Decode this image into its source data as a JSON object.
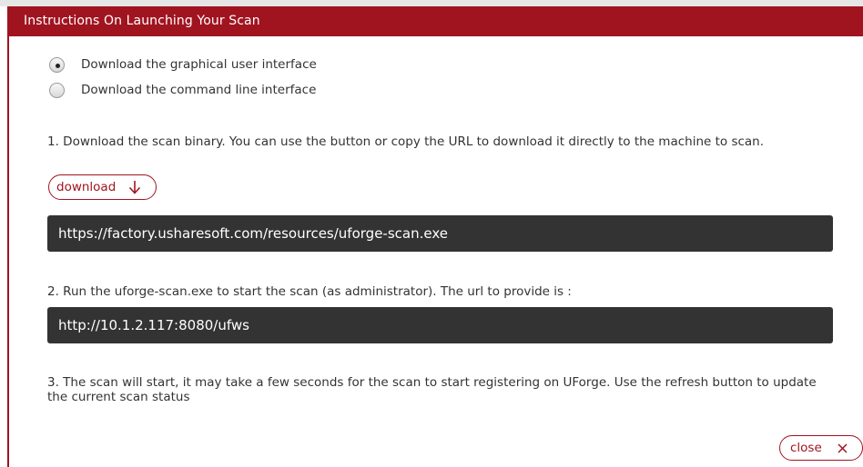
{
  "dialog": {
    "title": "Instructions On Launching Your Scan",
    "options": [
      {
        "label": "Download the graphical user interface",
        "selected": true
      },
      {
        "label": "Download the command line interface",
        "selected": false
      }
    ],
    "step1": "1. Download the scan binary. You can use the button or copy the URL to download it directly to the machine to scan.",
    "download_label": "download",
    "binary_url": "https://factory.usharesoft.com/resources/uforge-scan.exe",
    "step2": "2. Run the uforge-scan.exe to start the scan (as administrator). The url to provide is :",
    "ws_url": "http://10.1.2.117:8080/ufws",
    "step3": "3. The scan will start, it may take a few seconds for the scan to start registering on UForge. Use the refresh button to update the current scan status",
    "close_label": "close"
  },
  "colors": {
    "accent": "#a01420",
    "url_box": "#333333"
  },
  "icons": [
    "arrow-down-icon",
    "close-x-icon"
  ]
}
